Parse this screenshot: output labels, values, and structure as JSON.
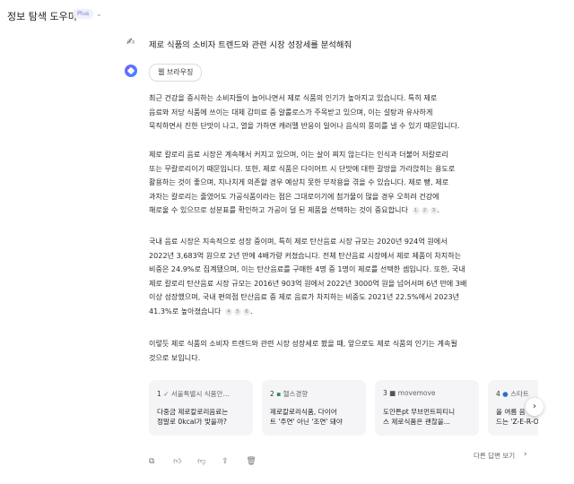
{
  "header": {
    "title": "정보 탐색 도우미",
    "badge": "Plus",
    "chevron": "⌄"
  },
  "question": {
    "icon": "✍",
    "text": "제로 식품의 소비자 트렌드와 관련 시장 성장세를 분석해줘"
  },
  "assistant": {
    "tool_chip": "웹 브라우징"
  },
  "paragraphs": [
    {
      "lines": [
        "최근 건강을 중시하는 소비자들이 늘어나면서 제로 식품의 인기가 높아지고 있습니다. 특히 제로",
        "음료와 저당 식품에 쓰이는 대체 감미료 중 알룰로스가 주목받고 있으며, 이는 설탕과 유사하게",
        "묵직하면서 진한 단맛이 나고, 열을 가하면 캐러멜 반응이 일어나 음식의 풍미를 낼 수 있기 때문입니다."
      ]
    },
    {
      "lines": [
        "제로 칼로리 음료 시장은 계속해서 커지고 있으며, 이는 살이 찌지 않는다는 인식과 더불어 저칼로리",
        "또는 무칼로리이기 때문입니다. 또한, 제로 식품은 다이어트 시 단맛에 대한 갈망을 가라앉히는 용도로",
        "활용하는 것이 좋으며, 지나치게 의존할 경우 예상치 못한 부작용을 겪을 수 있습니다. 제로 빵, 제로",
        "과자는 칼로리는 줄였어도 가공식품이라는 점은 그대로이기에 첨가물이 많을 경우 오히려 건강에",
        "해로울 수 있으므로 성분표를 확인하고 가공이 덜 된 제품을 선택하는 것이 중요합니다"
      ],
      "cites": [
        "1",
        "2",
        "3"
      ]
    },
    {
      "lines": [
        "국내 음료 시장은 지속적으로 성장 중이며, 특히 제로 탄산음료 시장 규모는 2020년 924억 원에서",
        "2022년 3,683억 원으로 2년 만에 4배가량 커졌습니다. 전체 탄산음료 시장에서 제로 제품이 차지하는",
        "비중은 24.9%로 집계됐으며, 이는 탄산음료를 구매한 4명 중 1명이 제로를 선택한 셈입니다. 또한, 국내",
        "제로 칼로리 탄산음료 시장 규모는 2016년 903억 원에서 2022년 3000억 원을 넘어서며 6년 만에 3배",
        "이상 성장했으며, 국내 편의점 탄산음료 중 제로 음료가 차지하는 비중도 2021년 22.5%에서 2023년",
        "41.3%로 높아졌습니다"
      ],
      "cites": [
        "4",
        "5",
        "6"
      ]
    },
    {
      "lines": [
        "이렇듯 제로 식품의 소비자 트렌드와 관련 시장 성장세로 봤을 때, 앞으로도 제로 식품의 인기는 계속될",
        "것으로 보입니다."
      ]
    }
  ],
  "sources": [
    {
      "num": "1",
      "source": "서울특별시 식품안...",
      "lines": [
        "다중금 제로칼로리음료는",
        "정말로 0kcal가 맞을까?"
      ]
    },
    {
      "num": "2",
      "source": "헬스경향",
      "lines": [
        "제로칼로리식품, 다이어",
        "트 '주연' 아닌 '조연' 돼야"
      ]
    },
    {
      "num": "3",
      "source": "movemove",
      "lines": [
        "도안튼pt 무브먼트피티니",
        "스 제로식품은 괜찮을..."
      ]
    },
    {
      "num": "4",
      "source": "스타트",
      "lines": [
        "올 여름 음",
        "드는 'Z-E-R-O'"
      ]
    }
  ],
  "actions": {
    "icons": [
      "copy-icon",
      "thumbs-up-icon",
      "thumbs-down-icon",
      "share-icon",
      "delete-icon"
    ],
    "other_answers": "다른 답변 보기",
    "other_chevron": "›"
  },
  "carousel_next": "›",
  "colors": {
    "badge_text": "#7a7ad9",
    "badge_bg": "#eef0fb",
    "card_bg": "#f5f5f7"
  }
}
